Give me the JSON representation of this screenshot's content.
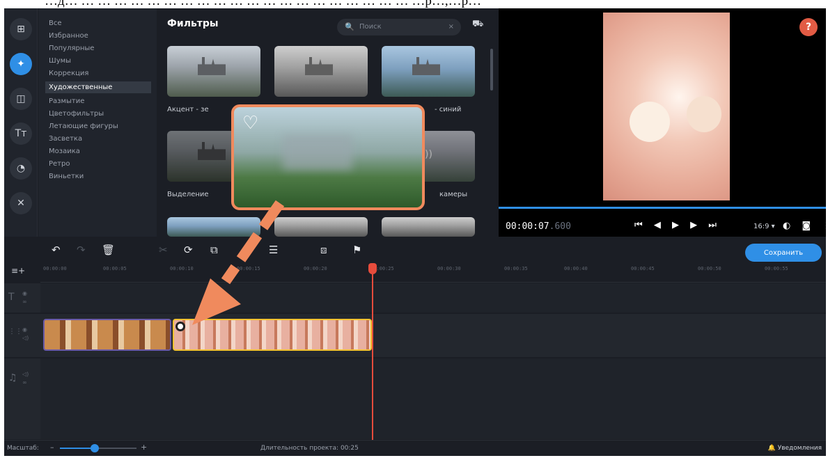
{
  "caption": "…д… … … … … … … … … … … … … … … … … … … … … …р…,…р…",
  "toolbar_left": {
    "icons": [
      "import-icon",
      "filters-wand-icon",
      "transitions-icon",
      "titles-icon",
      "stickers-icon",
      "tools-icon"
    ],
    "glyphs": [
      "⊞",
      "✦",
      "◫",
      "Tт",
      "◔",
      "✕"
    ]
  },
  "categories": [
    "Все",
    "Избранное",
    "Популярные",
    "Шумы",
    "Коррекция",
    "Художественные",
    "Размытие",
    "Цветофильтры",
    "Летающие фигуры",
    "Засветка",
    "Мозаика",
    "Ретро",
    "Виньетки"
  ],
  "active_category_index": 5,
  "filters": {
    "title": "Фильтры",
    "search_placeholder": "Поиск",
    "search_glyph": "🔍",
    "clear_glyph": "×",
    "cart_glyph": "⛟",
    "labels": [
      "Акцент - зе",
      "- синий",
      "Выделение",
      "камеры"
    ],
    "popup_heart": "♡",
    "sound_glyph": "))"
  },
  "preview": {
    "help": "?",
    "timecode": "00:00:07",
    "timecode_ms": ".600",
    "controls": "⏮ ◀ ▶ ▶ ⏭",
    "aspect": "16:9 ▾",
    "extra_icons": "◐ ◙ ⋮",
    "progress": 1.0
  },
  "timeline_toolbar": {
    "undo": "↶",
    "redo": "↷",
    "delete": "🗑",
    "cut": "✂",
    "rotate": "⟳",
    "crop": "⧉",
    "adjust": "☰",
    "clip_props": "⧈",
    "marker": "⚑",
    "save_label": "Сохранить"
  },
  "ruler_labels": [
    "00:00:00",
    "00:00:05",
    "00:00:10",
    "00:00:15",
    "00:00:20",
    "00:00:25",
    "00:00:30",
    "00:00:35",
    "00:00:40",
    "00:00:45",
    "00:00:50",
    "00:00:55"
  ],
  "track_glyphs": {
    "add": "≡+",
    "text": "T",
    "video": "⋮⋮",
    "audio": "♫",
    "eye": "◉",
    "link": "∞",
    "sound": "◁)"
  },
  "statusbar": {
    "scale_label": "Масштаб:",
    "minus": "–",
    "plus": "+",
    "scale_level": 0.45,
    "duration": "Длительность проекта: 00:25",
    "notifications": "Уведомления",
    "bell": "🔔"
  },
  "colors": {
    "accent": "#2f8fe6",
    "popup_border": "#f08a5d",
    "arrow": "#f08a5d",
    "playhead": "#e74c3c",
    "selected_clip": "#f2c230",
    "help": "#e25b44"
  }
}
